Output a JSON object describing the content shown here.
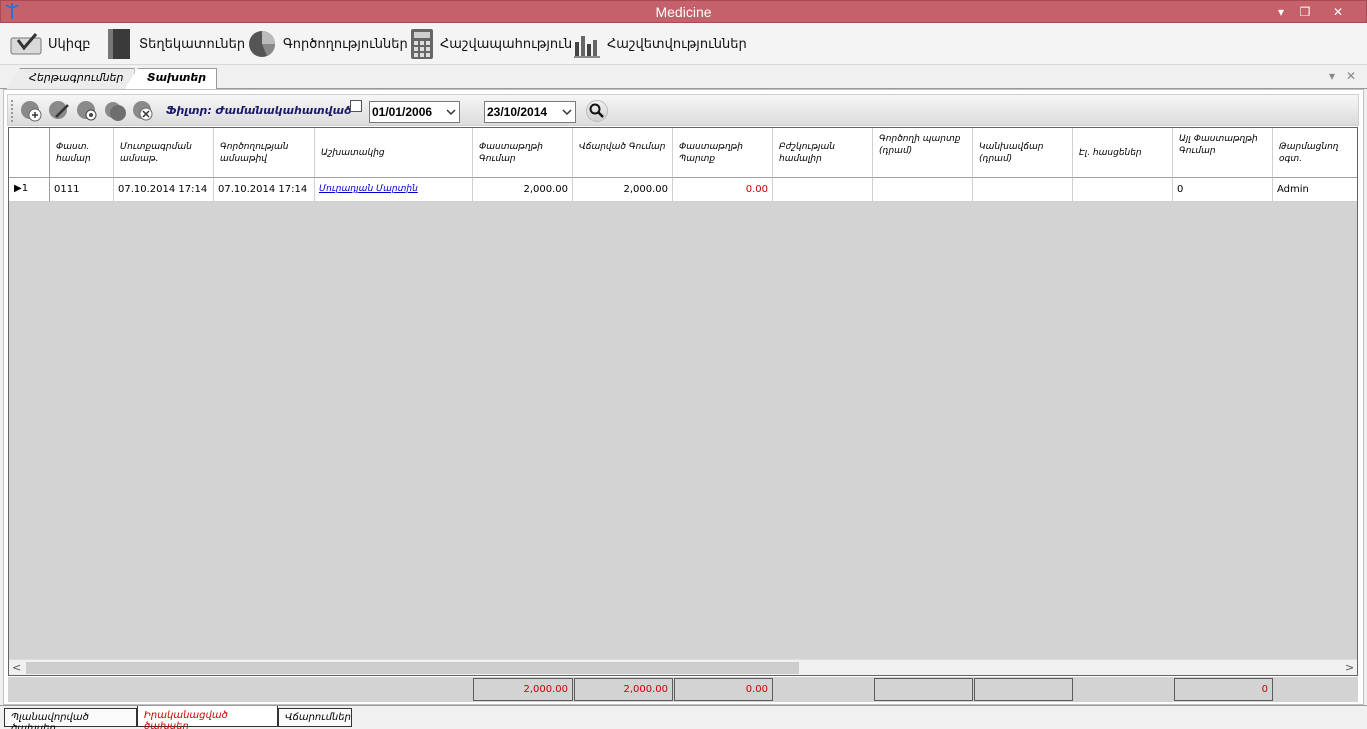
{
  "window": {
    "title": "Medicine",
    "minimize": "▾",
    "restore": "❐",
    "close": "✕"
  },
  "menu": [
    {
      "label": "Սկիզբ",
      "icon": "checkbox-tray-icon"
    },
    {
      "label": "Տեղեկատուներ",
      "icon": "book-icon"
    },
    {
      "label": "Գործողություններ",
      "icon": "pie-chart-icon"
    },
    {
      "label": "Հաշվապահություն",
      "icon": "calculator-icon"
    },
    {
      "label": "Հաշվետվություններ",
      "icon": "bar-chart-icon"
    }
  ],
  "tabs": [
    {
      "label": "Հերթագրումներ",
      "active": false
    },
    {
      "label": "Տախտեր",
      "active": true
    }
  ],
  "toolbar": {
    "filter_label": "Ֆիլտր: Ժամանակահատված՝",
    "date_from": "01/01/2006",
    "date_to": "23/10/2014",
    "buttons": [
      "add-icon",
      "edit-icon",
      "view-icon",
      "copy-icon",
      "delete-icon"
    ]
  },
  "grid": {
    "columns": [
      "Փաստ. համար",
      "Մուտքագրման ամսաթ.",
      "Գործողության ամսաթիվ",
      "Աշխատակից",
      "Փաստաթղթի Գումար",
      "Վճարված Գումար",
      "Փաստաթղթի Պարտք",
      "Բժշկության համալիր",
      "Գործողի պարտք (դրամ)",
      "Կանխավճար (դրամ)",
      "Էլ. հասցեներ",
      "Այլ Փաստաթղթի Գումար",
      "Թարմացնող օգտ."
    ],
    "rows": [
      {
        "num": "1",
        "cells": [
          "0111",
          "07.10.2014 17:14",
          "07.10.2014 17:14",
          "Մուրադյան Մարտին",
          "2,000.00",
          "2,000.00",
          "0.00",
          "",
          "",
          "",
          "",
          "0",
          "Admin"
        ]
      }
    ],
    "totals": [
      "2,000.00",
      "2,000.00",
      "0.00",
      "0"
    ]
  },
  "bottom_tabs": [
    {
      "label": "Պլանավորված ծախսեր",
      "active": false
    },
    {
      "label": "Իրականացված ծախսեր",
      "active": true
    },
    {
      "label": "Վճարումներ",
      "active": false
    }
  ],
  "colors": {
    "titlebar": "#c4616a",
    "negative": "#cc0000",
    "link": "#0000cc"
  }
}
